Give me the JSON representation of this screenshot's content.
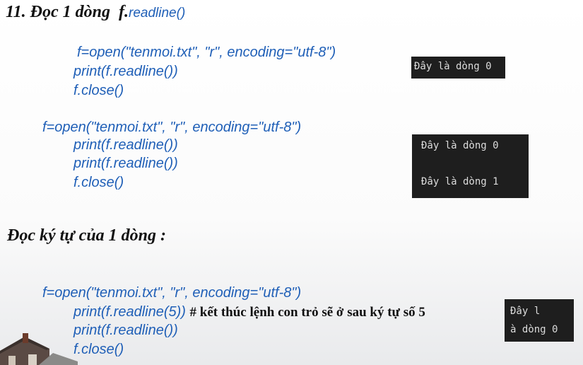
{
  "section1": {
    "title_prefix": "11. Đọc 1 dòng",
    "title_obj": "f.",
    "title_method": "readline()"
  },
  "example1": {
    "code": [
      "f=open(\"tenmoi.txt\", \"r\", encoding=\"utf-8\")",
      "print(f.readline())",
      "f.close()"
    ],
    "output": [
      "Đây là dòng 0"
    ]
  },
  "example2": {
    "code": [
      "f=open(\"tenmoi.txt\", \"r\", encoding=\"utf-8\")",
      "print(f.readline())",
      "print(f.readline())",
      "f.close()"
    ],
    "output": [
      "Đây là dòng 0",
      "Đây là dòng 1"
    ]
  },
  "section2": {
    "title": "Đọc ký tự của 1 dòng :"
  },
  "example3": {
    "code": [
      "f=open(\"tenmoi.txt\", \"r\", encoding=\"utf-8\")",
      "print(f.readline(5))",
      "print(f.readline())",
      "f.close()"
    ],
    "comment": "# kết thúc lệnh con trỏ sẽ ở sau ký tự số 5",
    "output": [
      "Đây l",
      "à dòng 0"
    ]
  },
  "colors": {
    "code": "#1f5fb7",
    "heading": "#111111",
    "terminal_bg": "#1e1e1e",
    "terminal_text": "#dcdcdc"
  }
}
